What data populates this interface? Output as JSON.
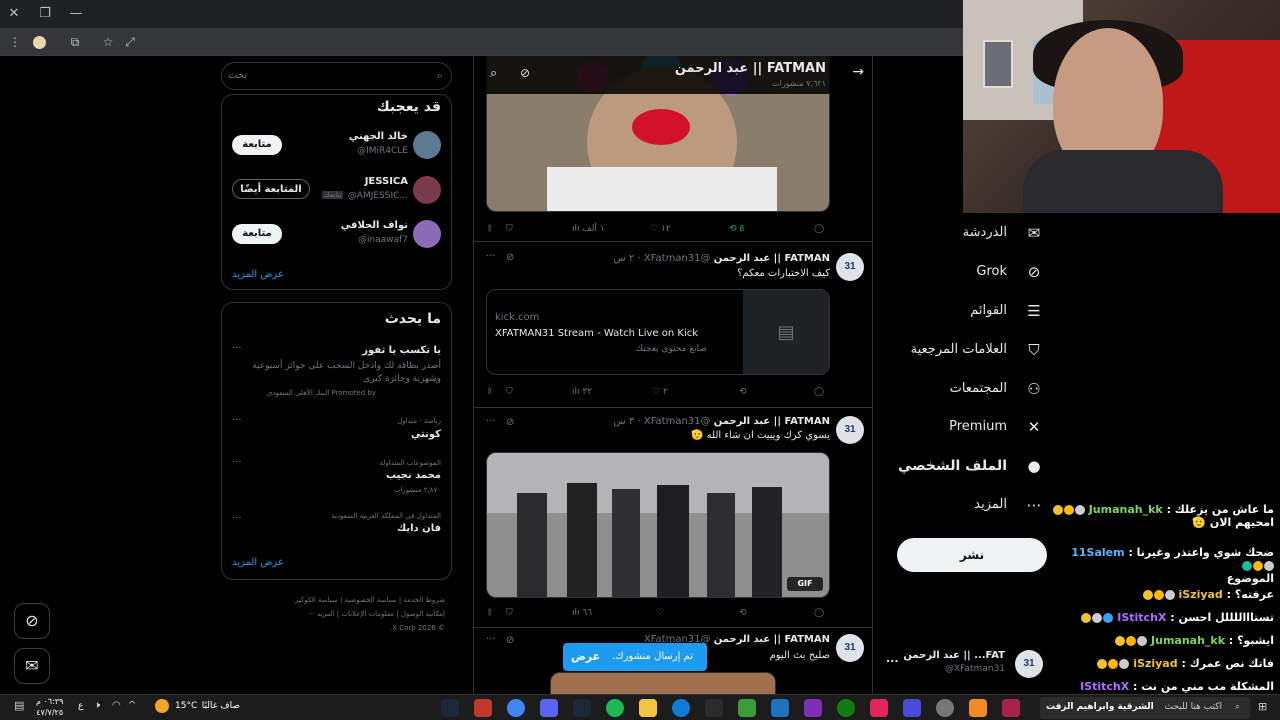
{
  "browser": {
    "window_controls": {
      "close": "✕",
      "restore": "❐",
      "minimize": "—"
    },
    "toolbar_icons": [
      "menu-icon",
      "profile-icon",
      "extensions-icon",
      "bookmark-star-icon",
      "tab-search-icon"
    ]
  },
  "header": {
    "name": "FATMAN || عبد الرحمن",
    "posts_count": "٧,٦٢١ منشورات"
  },
  "tweets": [
    {
      "actions": {
        "reply": "",
        "retweet": "٥",
        "like": "١٢",
        "views": "١ ألف"
      }
    },
    {
      "author": "FATMAN || عبد الرحمن",
      "handle": "@XFatman31",
      "time": "· ٢ س",
      "text": "كيف الاختبارات معكم؟",
      "card": {
        "domain": "kick.com",
        "title": "XFATMAN31 Stream - Watch Live on Kick",
        "subtitle": "صانع محتوى يعجبك"
      },
      "actions": {
        "reply": "",
        "retweet": "",
        "like": "٢",
        "views": "٣٢"
      }
    },
    {
      "author": "FATMAN || عبد الرحمن",
      "handle": "@XFatman31",
      "time": "· ٣ س",
      "text": "يسوي كرك ويبيت ان شاء الله 🫡",
      "gif_badge": "GIF",
      "actions": {
        "reply": "",
        "retweet": "",
        "like": "",
        "views": "٦٦"
      }
    },
    {
      "author": "FATMAN || عبد الرحمن",
      "handle": "@XFatman31",
      "text": "صليح بث اليوم"
    }
  ],
  "toast": {
    "text": "تم إرسال منشورك.",
    "action": "عرض"
  },
  "sidebar": {
    "search_placeholder": "بحث",
    "who_to_follow": {
      "title": "قد يعجبك",
      "users": [
        {
          "name": "خالد الجهني",
          "handle": "@IMiR4CLE",
          "button": "متابعة"
        },
        {
          "name": "JESSICA",
          "handle": "@AMJESSIC...",
          "badge": "يتابعك",
          "button": "المتابعة أيضًا"
        },
        {
          "name": "نواف الحلافي",
          "handle": "@inaawaf7",
          "button": "متابعة"
        }
      ],
      "show_more": "عرض المزيد"
    },
    "trends": {
      "title": "ما يحدث",
      "promo": {
        "title": "يا تكسب يا تفوز",
        "text": "أصدر بطاقة لك وادخل السحب على جوائز أسبوعية وشهرية وجائزة كبرى",
        "promoted_by": "Promoted by البنك الأهلي السعودي"
      },
      "items": [
        {
          "context": "رياضة · متداول",
          "name": "كونتي",
          "count": ""
        },
        {
          "context": "الموضوعات المتداولة",
          "name": "محمد نجيب",
          "count": "٢,٨٧٠ منشورات"
        },
        {
          "context": "المتداول في المملكة العربية السعودية",
          "name": "فان دايك",
          "count": ""
        }
      ],
      "show_more": "عرض المزيد"
    },
    "footer": {
      "links": [
        "شروط الخدمة",
        "سياسة الخصوصية",
        "سياسة الكوكيز",
        "إمكانية الوصول",
        "معلومات الإعلانات",
        "المزيد ···"
      ],
      "copyright": "© 2026 X Corp."
    }
  },
  "nav": {
    "items": [
      {
        "label": "الدردشة",
        "icon": "mail-icon"
      },
      {
        "label": "Grok",
        "icon": "grok-icon"
      },
      {
        "label": "القوائم",
        "icon": "list-icon"
      },
      {
        "label": "العلامات المرجعية",
        "icon": "bookmark-icon"
      },
      {
        "label": "المجتمعات",
        "icon": "communities-icon"
      },
      {
        "label": "Premium",
        "icon": "x-icon"
      },
      {
        "label": "الملف الشخصي",
        "icon": "person-icon"
      },
      {
        "label": "المزيد",
        "icon": "more-icon"
      }
    ],
    "post_button": "نشر",
    "account": {
      "name": "FAT... || عبد الرحمن",
      "handle": "@XFatman31",
      "more": "..."
    }
  },
  "chat": [
    {
      "user": "Jumanah_kk",
      "message": "ما عاش من يزعلك :",
      "extra": "امحيهم الان 🫡",
      "color": "#7fd65c"
    },
    {
      "user": "11Salem",
      "message": "ضحك شوي واعتذر وغيرنا :",
      "extra": "الموضوع",
      "color": "#5ab3ff"
    },
    {
      "user": "iSziyad",
      "message": "عرفته؟ :",
      "color": "#f2c230"
    },
    {
      "user": "IStitchX",
      "message": "تستاااللللل احسن :",
      "color": "#b06cff"
    },
    {
      "user": "Jumanah_kk",
      "message": "ايشبو؟ :",
      "color": "#7fd65c"
    },
    {
      "user": "iSziyad",
      "message": "فاتك نص عمرك :",
      "color": "#f2c230"
    },
    {
      "user": "IStitchX",
      "message": "المشكلة مب مني من نت :",
      "color": "#b06cff"
    }
  ],
  "taskbar": {
    "search_placeholder": "اكتب هنا للبحث",
    "weather_temp": "15°C",
    "weather_text": "صاف غالبًا",
    "overflow_text": "الشرقية وابراهيم الزفت",
    "time": "٠٦:٣٩ م",
    "date": "٤٧/٧/٢٥",
    "lang": "ع"
  }
}
